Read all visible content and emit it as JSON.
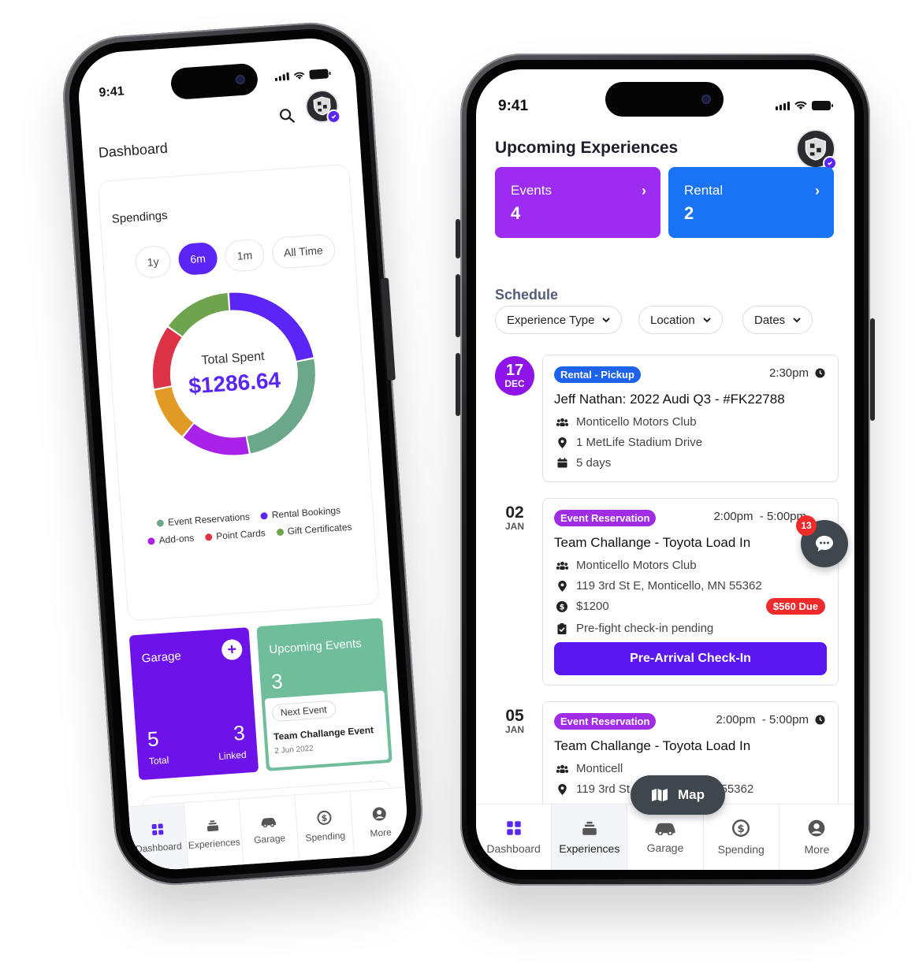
{
  "colors": {
    "primary": "#5b17f0",
    "events_card": "#9b2cf0",
    "rental_card": "#1a73f5",
    "garage_card": "#6d12e8",
    "upcoming_card": "#6fbd9b",
    "tag_blue": "#1f62ea",
    "tag_purple": "#a12ce6",
    "due_red": "#ee2a2a",
    "fab_dark": "#3f464c"
  },
  "left_phone": {
    "status_time": "9:41",
    "title": "Dashboard",
    "spendings": {
      "title": "Spendings",
      "ranges": [
        "1y",
        "6m",
        "1m",
        "All Time"
      ],
      "selected_range": "6m",
      "total_label": "Total Spent",
      "total_value": "$1286.64"
    },
    "chart_data": {
      "type": "pie",
      "title": "",
      "categories": [
        "Event Reservations",
        "Rental Bookings",
        "Add-ons",
        "Point Cards",
        "Gift Certificates"
      ],
      "values": [
        25,
        23,
        14,
        13,
        14
      ],
      "extra_segments": [
        {
          "label": "",
          "value": 11
        }
      ],
      "colors": [
        "#6aa889",
        "#5b26f5",
        "#a922e8",
        "#dd3347",
        "#6fa44f"
      ],
      "segment_order_clockwise_from_top": [
        {
          "color": "#5b26f5",
          "value": 23
        },
        {
          "color": "#6aa889",
          "value": 25
        },
        {
          "color": "#a922e8",
          "value": 14
        },
        {
          "color": "#e09a25",
          "value": 11
        },
        {
          "color": "#dd3347",
          "value": 13
        },
        {
          "color": "#6fa44f",
          "value": 14
        }
      ]
    },
    "legend": [
      {
        "label": "Event Reservations",
        "color": "#6aa889"
      },
      {
        "label": "Rental Bookings",
        "color": "#5b26f5"
      },
      {
        "label": "Add-ons",
        "color": "#a922e8"
      },
      {
        "label": "Point Cards",
        "color": "#dd3347"
      },
      {
        "label": "Gift Certificates",
        "color": "#6fa44f"
      }
    ],
    "garage": {
      "title": "Garage",
      "plus": "+",
      "total_value": "5",
      "total_label": "Total",
      "linked_value": "3",
      "linked_label": "Linked"
    },
    "upcoming": {
      "title": "Upcoming Events",
      "count": "3",
      "next_label": "Next Event",
      "next_name": "Team Challange Event",
      "next_date": "2 Jun 2022"
    },
    "tabs": [
      {
        "label": "Dashboard",
        "icon": "grid-icon"
      },
      {
        "label": "Experiences",
        "icon": "stack-icon"
      },
      {
        "label": "Garage",
        "icon": "car-icon"
      },
      {
        "label": "Spending",
        "icon": "dollar-icon"
      },
      {
        "label": "More",
        "icon": "user-icon"
      }
    ]
  },
  "right_phone": {
    "status_time": "9:41",
    "title": "Upcoming Experiences",
    "stats": [
      {
        "label": "Events",
        "value": "4",
        "chevron": "›"
      },
      {
        "label": "Rental",
        "value": "2",
        "chevron": "›"
      }
    ],
    "schedule_title": "Schedule",
    "filters": [
      "Experience Type",
      "Location",
      "Dates"
    ],
    "items": [
      {
        "day": "17",
        "month": "DEC",
        "tag": "Rental - Pickup",
        "time": "2:30pm",
        "title": "Jeff Nathan: 2022 Audi Q3 - #FK22788",
        "club": "Monticello Motors Club",
        "address": "1 MetLife Stadium Drive",
        "duration": "5 days"
      },
      {
        "day": "02",
        "month": "JAN",
        "tag": "Event Reservation",
        "time": "2:00pm  - 5:00pm",
        "title": "Team Challange - Toyota Load In",
        "club": "Monticello Motors Club",
        "address": "119 3rd St E, Monticello, MN 55362",
        "price": "$1200",
        "due": "$560 Due",
        "checkin_status": "Pre-fight check-in pending",
        "cta": "Pre-Arrival Check-In"
      },
      {
        "day": "05",
        "month": "JAN",
        "tag": "Event Reservation",
        "time": "2:00pm  - 5:00pm",
        "title": "Team Challange - Toyota Load In",
        "club": "Monticell",
        "address_start": "119 3rd St",
        "address_end": "MN 55362"
      }
    ],
    "chat_badge": "13",
    "map_label": "Map",
    "tabs": [
      {
        "label": "Dashboard",
        "icon": "grid-icon"
      },
      {
        "label": "Experiences",
        "icon": "stack-icon"
      },
      {
        "label": "Garage",
        "icon": "car-icon"
      },
      {
        "label": "Spending",
        "icon": "dollar-icon"
      },
      {
        "label": "More",
        "icon": "user-icon"
      }
    ]
  }
}
